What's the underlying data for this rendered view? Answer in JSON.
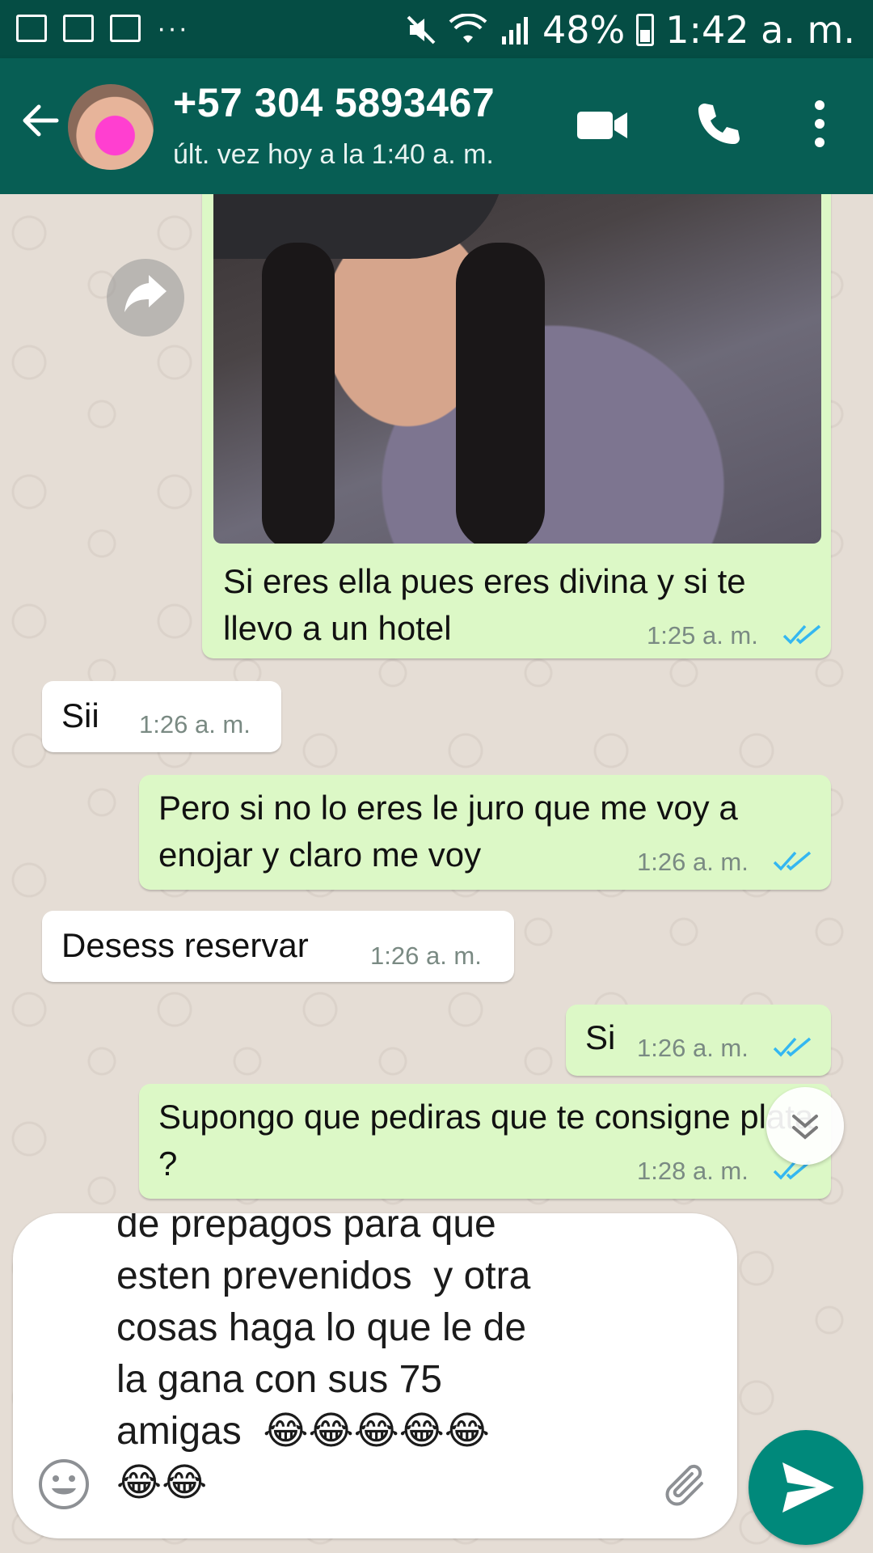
{
  "status_bar": {
    "battery": "48%",
    "time": "1:42 a. m.",
    "dots": "···"
  },
  "header": {
    "contact": "+57 304 5893467",
    "last_seen": "últ. vez hoy a la 1:40 a. m."
  },
  "messages": [
    {
      "dir": "out",
      "text": "Si eres ella pues eres divina y si te llevo a un hotel",
      "time": "1:25 a. m.",
      "read": true,
      "has_image": true
    },
    {
      "dir": "in",
      "text": "Sii",
      "time": "1:26 a. m."
    },
    {
      "dir": "out",
      "text": "Pero si no lo eres le juro que me voy a enojar y claro me voy",
      "time": "1:26 a. m.",
      "read": true
    },
    {
      "dir": "in",
      "text": "Desess reservar",
      "time": "1:26 a. m."
    },
    {
      "dir": "out",
      "text": "Si",
      "time": "1:26 a. m.",
      "read": true
    },
    {
      "dir": "out",
      "text": "Supongo que pediras que te consigne plata ?",
      "time": "1:28 a. m.",
      "read": true
    }
  ],
  "composer": {
    "text": "de prepagos para que\nesten prevenidos  y otra\ncosas haga lo que le de\nla gana con sus 75\namigas  😂😂😂😂😂\n😂😂"
  },
  "colors": {
    "header": "#075e54",
    "status_bar": "#054d44",
    "outgoing_bubble": "#dcf8c6",
    "incoming_bubble": "#ffffff",
    "read_ticks": "#34b7f1",
    "send_button": "#00897b"
  }
}
